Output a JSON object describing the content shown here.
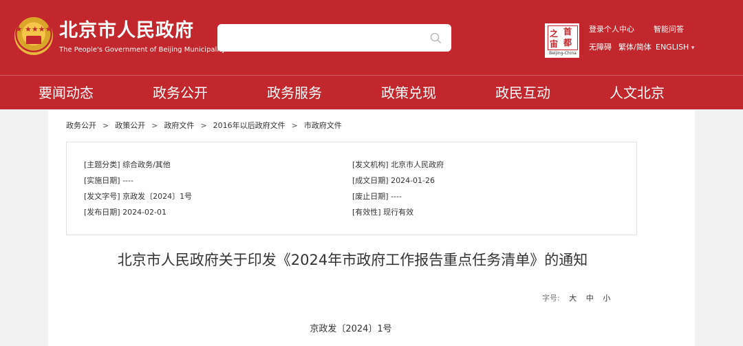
{
  "header": {
    "site_title": "北京市人民政府",
    "site_subtitle": "The People's Government of Beijing Municipality",
    "search": {
      "placeholder": ""
    },
    "capital_logo": {
      "chars": [
        "之",
        "首",
        "宙",
        "都"
      ],
      "caption": "Beijing-China"
    },
    "links": {
      "login": "登录个人中心",
      "qa": "智能问答",
      "accessible": "无障碍",
      "trad_simp": "繁体/简体",
      "english": "ENGLISH",
      "english_arrow": "▾"
    }
  },
  "nav": {
    "items": [
      {
        "label": "要闻动态"
      },
      {
        "label": "政务公开"
      },
      {
        "label": "政务服务"
      },
      {
        "label": "政策兑现"
      },
      {
        "label": "政民互动"
      },
      {
        "label": "人文北京"
      }
    ]
  },
  "breadcrumb": {
    "items": [
      "政务公开",
      "政策公开",
      "政府文件",
      "2016年以后政府文件",
      "市政府文件"
    ],
    "separator": ">"
  },
  "info": {
    "topic": "[主题分类] 综合政务/其他",
    "effective_date": "[实施日期] ----",
    "doc_number": "[发文字号] 京政发〔2024〕1号",
    "publish_date": "[发布日期] 2024-02-01",
    "issuer": "[发文机构] 北京市人民政府",
    "created_date": "[成文日期] 2024-01-26",
    "expiry_date": "[废止日期] ----",
    "validity": "[有效性] 现行有效"
  },
  "document": {
    "title": "北京市人民政府关于印发《2024年市政府工作报告重点任务清单》的通知",
    "font_size_label": "字号:",
    "font_large": "大",
    "font_medium": "中",
    "font_small": "小",
    "doc_number_line": "京政发〔2024〕1号"
  },
  "colors": {
    "brand_red": "#c1272d",
    "background": "#f2f2f2",
    "text": "#333333"
  }
}
